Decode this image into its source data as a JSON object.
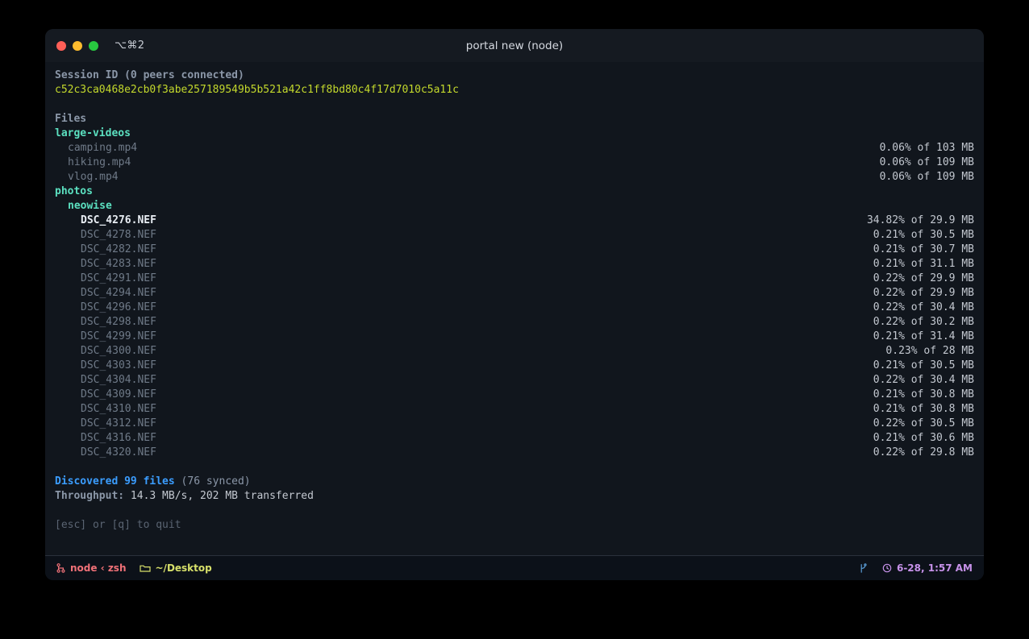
{
  "window": {
    "title": "portal new (node)",
    "tab_shortcut": "⌥⌘2",
    "traffic_lights": [
      "close-red",
      "minimize-yellow",
      "zoom-green"
    ]
  },
  "session": {
    "header": "Session ID (0 peers connected)",
    "id": "c52c3ca0468e2cb0f3abe257189549b5b521a42c1ff8bd80c4f17d7010c5a11c"
  },
  "files_section": {
    "header": "Files",
    "entries": [
      {
        "type": "dir",
        "name": "large-videos",
        "indent": 0,
        "size": ""
      },
      {
        "type": "file",
        "name": "camping.mp4",
        "indent": 1,
        "size": "0.06% of 103 MB",
        "active": false
      },
      {
        "type": "file",
        "name": "hiking.mp4",
        "indent": 1,
        "size": "0.06% of 109 MB",
        "active": false
      },
      {
        "type": "file",
        "name": "vlog.mp4",
        "indent": 1,
        "size": "0.06% of 109 MB",
        "active": false
      },
      {
        "type": "dir",
        "name": "photos",
        "indent": 0,
        "size": ""
      },
      {
        "type": "dir",
        "name": "neowise",
        "indent": 1,
        "size": ""
      },
      {
        "type": "file",
        "name": "DSC_4276.NEF",
        "indent": 2,
        "size": "34.82% of 29.9 MB",
        "active": true
      },
      {
        "type": "file",
        "name": "DSC_4278.NEF",
        "indent": 2,
        "size": "0.21% of 30.5 MB",
        "active": false
      },
      {
        "type": "file",
        "name": "DSC_4282.NEF",
        "indent": 2,
        "size": "0.21% of 30.7 MB",
        "active": false
      },
      {
        "type": "file",
        "name": "DSC_4283.NEF",
        "indent": 2,
        "size": "0.21% of 31.1 MB",
        "active": false
      },
      {
        "type": "file",
        "name": "DSC_4291.NEF",
        "indent": 2,
        "size": "0.22% of 29.9 MB",
        "active": false
      },
      {
        "type": "file",
        "name": "DSC_4294.NEF",
        "indent": 2,
        "size": "0.22% of 29.9 MB",
        "active": false
      },
      {
        "type": "file",
        "name": "DSC_4296.NEF",
        "indent": 2,
        "size": "0.22% of 30.4 MB",
        "active": false
      },
      {
        "type": "file",
        "name": "DSC_4298.NEF",
        "indent": 2,
        "size": "0.22% of 30.2 MB",
        "active": false
      },
      {
        "type": "file",
        "name": "DSC_4299.NEF",
        "indent": 2,
        "size": "0.21% of 31.4 MB",
        "active": false
      },
      {
        "type": "file",
        "name": "DSC_4300.NEF",
        "indent": 2,
        "size": "0.23% of 28 MB",
        "active": false
      },
      {
        "type": "file",
        "name": "DSC_4303.NEF",
        "indent": 2,
        "size": "0.21% of 30.5 MB",
        "active": false
      },
      {
        "type": "file",
        "name": "DSC_4304.NEF",
        "indent": 2,
        "size": "0.22% of 30.4 MB",
        "active": false
      },
      {
        "type": "file",
        "name": "DSC_4309.NEF",
        "indent": 2,
        "size": "0.21% of 30.8 MB",
        "active": false
      },
      {
        "type": "file",
        "name": "DSC_4310.NEF",
        "indent": 2,
        "size": "0.21% of 30.8 MB",
        "active": false
      },
      {
        "type": "file",
        "name": "DSC_4312.NEF",
        "indent": 2,
        "size": "0.22% of 30.5 MB",
        "active": false
      },
      {
        "type": "file",
        "name": "DSC_4316.NEF",
        "indent": 2,
        "size": "0.21% of 30.6 MB",
        "active": false
      },
      {
        "type": "file",
        "name": "DSC_4320.NEF",
        "indent": 2,
        "size": "0.22% of 29.8 MB",
        "active": false
      }
    ]
  },
  "summary": {
    "discovered": "Discovered 99 files",
    "synced": " (76 synced)",
    "throughput_label": "Throughput:",
    "throughput_value": " 14.3 MB/s, 202 MB transferred",
    "quit_hint": "[esc] or [q] to quit"
  },
  "statusbar": {
    "process": "node ‹ zsh",
    "path": "~/Desktop",
    "time": "6-28, 1:57 AM",
    "icons": [
      "process-icon",
      "folder-icon",
      "git-branch-icon",
      "clock-icon"
    ]
  },
  "colors": {
    "page_background": "#000000",
    "window_background": "#11161d",
    "titlebar": "#151a21",
    "statusbar": "#0c1119",
    "session_hash": "#c3d82c",
    "directory": "#5be0c0",
    "discovered": "#3b9dff",
    "active_file": "#e8edf3",
    "dim_file": "#6f7a88",
    "status_process": "#f07178",
    "status_path": "#d7e06a",
    "status_time": "#c792ea",
    "status_branch": "#5a9dd6"
  }
}
